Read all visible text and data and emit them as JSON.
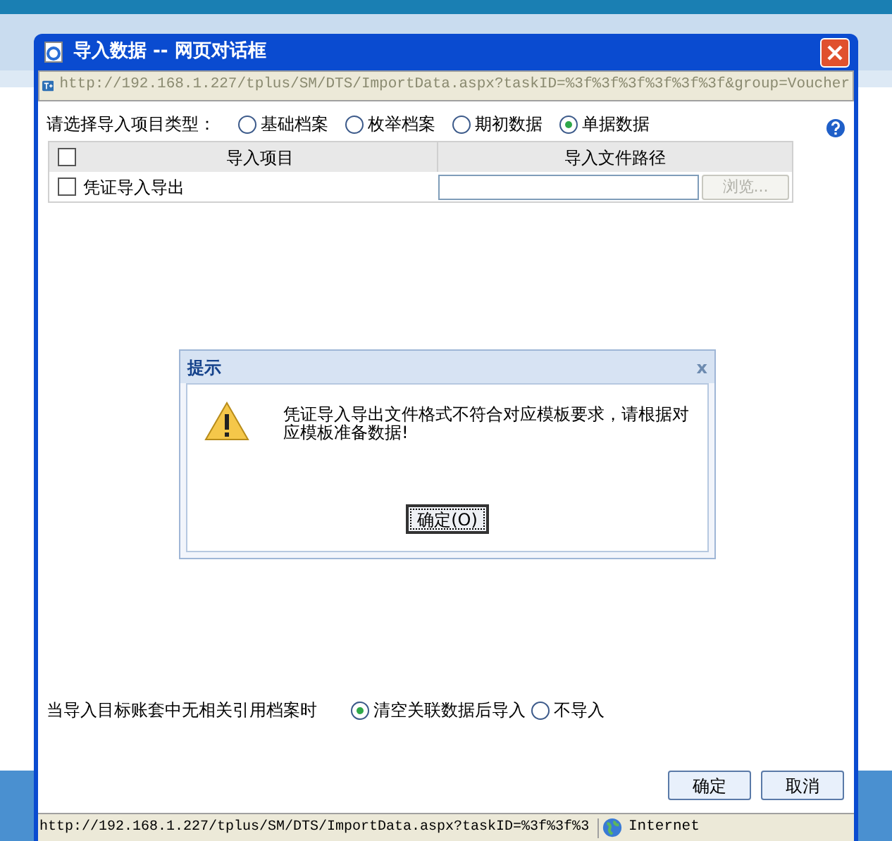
{
  "window": {
    "title": "导入数据 -- 网页对话框",
    "address": "http://192.168.1.227/tplus/SM/DTS/ImportData.aspx?taskID=%3f%3f%3f%3f%3f%3f&group=Voucher"
  },
  "type_label": "请选择导入项目类型：",
  "types": [
    {
      "label": "基础档案",
      "selected": false
    },
    {
      "label": "枚举档案",
      "selected": false
    },
    {
      "label": "期初数据",
      "selected": false
    },
    {
      "label": "单据数据",
      "selected": true
    }
  ],
  "table": {
    "columns": [
      "导入项目",
      "导入文件路径"
    ],
    "all_checked": false,
    "rows": [
      {
        "name": "凭证导入导出",
        "checked": false,
        "path": "",
        "browse": "浏览...",
        "browse_disabled": true
      }
    ]
  },
  "alert": {
    "title": "提示",
    "close": "x",
    "message": "凭证导入导出文件格式不符合对应模板要求，请根据对应模板准备数据!",
    "button": "确定(O)"
  },
  "missing_label": "当导入目标账套中无相关引用档案时",
  "missing_options": [
    {
      "label": "清空关联数据后导入",
      "selected": true
    },
    {
      "label": "不导入",
      "selected": false
    }
  ],
  "buttons": [
    "确定",
    "取消"
  ],
  "status_bar": {
    "url": "http://192.168.1.227/tplus/SM/DTS/ImportData.aspx?taskID=%3f%3f%3",
    "zone": "Internet"
  }
}
